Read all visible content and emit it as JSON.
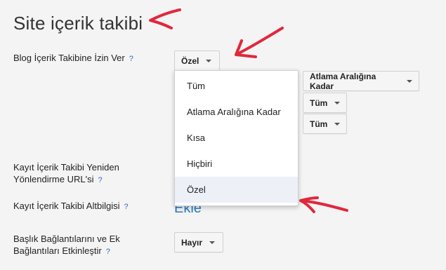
{
  "page": {
    "title": "Site içerik takibi"
  },
  "settings": {
    "blog_follow_label": "Blog İçerik Takibine İzin Ver",
    "blog_follow_value": "Özel",
    "redirect_label_line1": "Kayıt İçerik Takibi Yeniden",
    "redirect_label_line2": "Yönlendirme URL'si",
    "footer_label": "Kayıt İçerik Takibi Altbilgisi",
    "footer_link": "Ekle",
    "header_links_label_line1": "Başlık Bağlantılarını ve Ek",
    "header_links_label_line2": "Bağlantıları Etkinleştir",
    "header_links_value": "Hayır",
    "help_symbol": "?"
  },
  "right_selects": {
    "break": "Atlama Aralığına Kadar",
    "first": "Tüm",
    "second": "Tüm"
  },
  "dropdown": {
    "items": [
      "Tüm",
      "Atlama Aralığına Kadar",
      "Kısa",
      "Hiçbiri",
      "Özel"
    ],
    "selected": "Özel"
  },
  "annotations": {
    "color": "#e0283c"
  }
}
